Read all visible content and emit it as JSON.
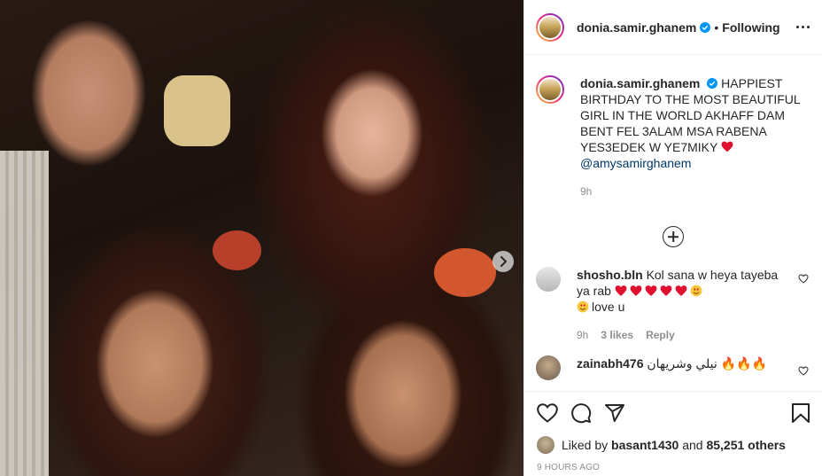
{
  "post": {
    "username": "donia.samir.ghanem",
    "follow_status": "Following",
    "caption": "HAPPIEST BIRTHDAY TO THE MOST BEAUTIFUL GIRL IN THE WORLD AKHAFF DAM BENT FEL 3ALAM MSA RABENA YES3EDEK W YE7MIKY",
    "caption_mention": "@amysamirghanem",
    "caption_age": "9h"
  },
  "comments": [
    {
      "username": "shosho.bln",
      "text": "Kol sana w heya tayeba ya rab",
      "text2": "love u",
      "age": "9h",
      "likes": "3 likes",
      "reply_label": "Reply"
    },
    {
      "username": "zainabh476",
      "text": "نيلي وشريهان"
    }
  ],
  "footer": {
    "liked_by_prefix": "Liked by",
    "liked_by_user": "basant1430",
    "liked_by_and": "and",
    "liked_by_others": "85,251 others",
    "timestamp": "9 hours ago"
  },
  "colors": {
    "text": "#262626",
    "muted": "#8e8e8e",
    "link": "#00376b",
    "verified": "#0095f6",
    "heart": "#ed4956"
  },
  "icons": [
    "verified-badge-icon",
    "more-options-icon",
    "add-circle-icon",
    "heart-outline-icon",
    "comment-icon",
    "share-icon",
    "bookmark-icon",
    "carousel-next-icon"
  ]
}
